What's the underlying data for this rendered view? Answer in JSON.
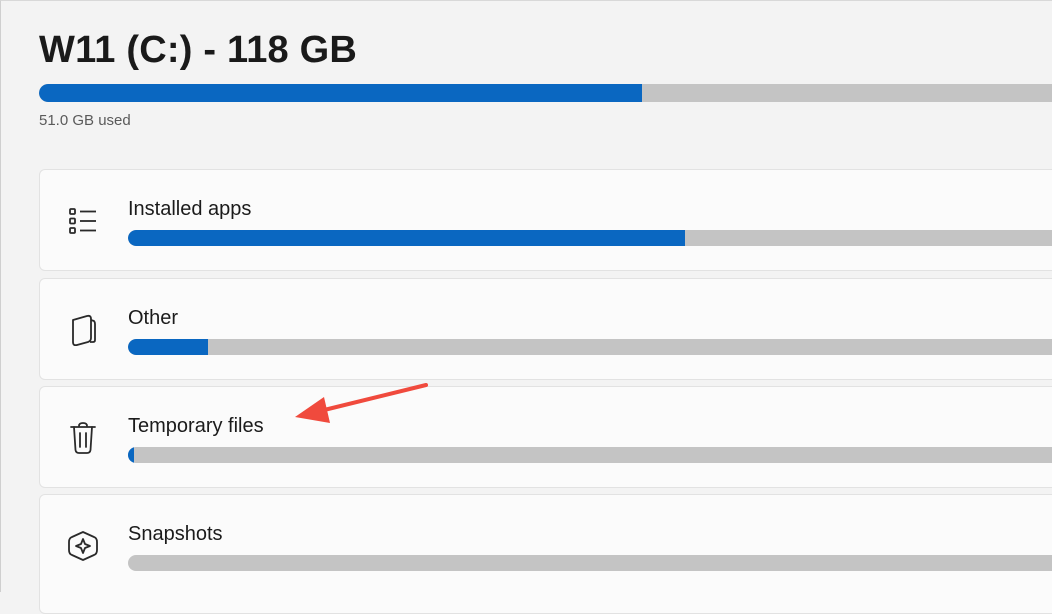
{
  "drive": {
    "title": "W11 (C:) - 118 GB",
    "used_label": "51.0 GB used",
    "used_fraction": 0.585
  },
  "categories": [
    {
      "label": "Installed apps",
      "icon": "installed-apps-list-icon",
      "usage_fraction": 0.58
    },
    {
      "label": "Other",
      "icon": "other-folder-icon",
      "usage_fraction": 0.083
    },
    {
      "label": "Temporary files",
      "icon": "trash-icon",
      "usage_fraction": 0.006
    },
    {
      "label": "Snapshots",
      "icon": "snapshots-icon",
      "usage_fraction": 0.0
    }
  ],
  "colors": {
    "accent": "#0a67c1",
    "track": "#c4c4c4",
    "annotation_arrow": "#f04a3d"
  }
}
